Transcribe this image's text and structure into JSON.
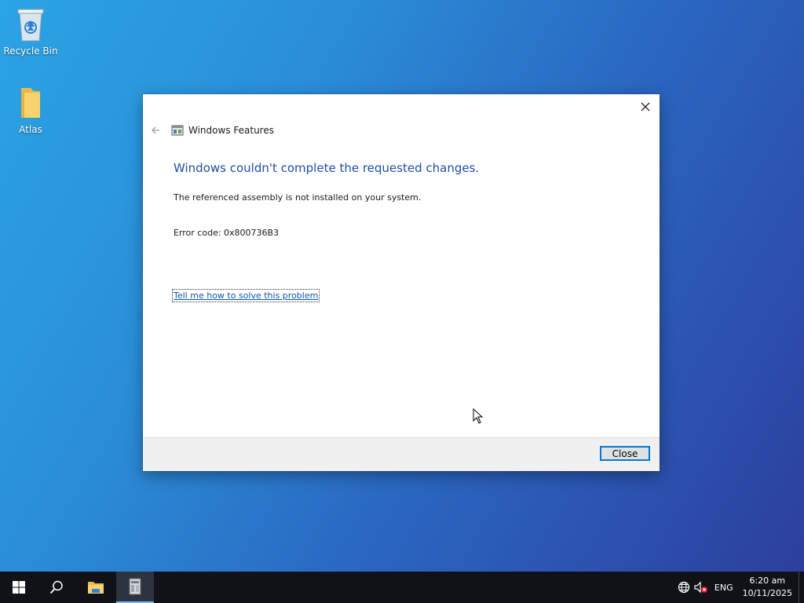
{
  "desktop": {
    "icons": [
      {
        "label": "Recycle Bin",
        "icon": "recycle-bin-icon"
      },
      {
        "label": "Atlas",
        "icon": "folder-icon"
      }
    ]
  },
  "dialog": {
    "title": "Windows Features",
    "main_instruction": "Windows couldn't complete the requested changes.",
    "message": "The referenced assembly is not installed on your system.",
    "error_code": "Error code: 0x800736B3",
    "help_link": "Tell me how to solve this problem",
    "close_button": "Close"
  },
  "taskbar": {
    "apps": [
      "start-icon",
      "search-icon",
      "file-explorer-icon",
      "windows-features-icon"
    ],
    "language": "ENG",
    "time": "6:20 am",
    "date": "10/11/2025"
  },
  "colors": {
    "accent": "#0078d7",
    "instruction_blue": "#1f4fa3",
    "link_blue": "#0b57b0",
    "taskbar": "#101217"
  }
}
